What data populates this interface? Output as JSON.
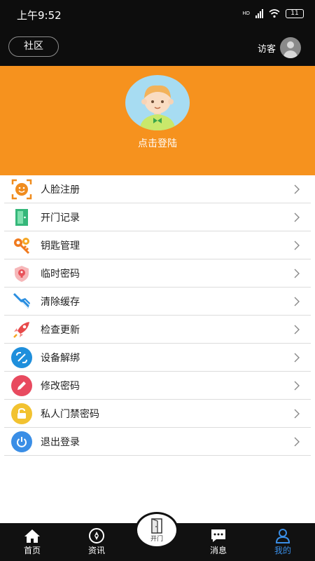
{
  "status_bar": {
    "time": "上午9:52",
    "network": "HD",
    "battery": "11"
  },
  "header": {
    "community_label": "社区",
    "visitor_label": "访客"
  },
  "profile": {
    "login_text": "点击登陆"
  },
  "menu": [
    {
      "label": "人脸注册",
      "icon": "face-scan-icon",
      "color": "#f08c1e"
    },
    {
      "label": "开门记录",
      "icon": "door-record-icon",
      "color": "#35b77a"
    },
    {
      "label": "钥匙管理",
      "icon": "key-icon",
      "color": "#f07a1e"
    },
    {
      "label": "临时密码",
      "icon": "temp-password-icon",
      "color": "#e8535a"
    },
    {
      "label": "清除缓存",
      "icon": "broom-icon",
      "color": "#2a8ee0"
    },
    {
      "label": "检查更新",
      "icon": "rocket-icon",
      "color": "#e84a4a"
    },
    {
      "label": "设备解绑",
      "icon": "unbind-icon",
      "color": "#1f8fdc"
    },
    {
      "label": "修改密码",
      "icon": "pencil-icon",
      "color": "#e84a5f"
    },
    {
      "label": "私人门禁密码",
      "icon": "lock-icon",
      "color": "#f2c230"
    },
    {
      "label": "退出登录",
      "icon": "power-icon",
      "color": "#3a8ee6"
    }
  ],
  "bottom_nav": {
    "home": "首页",
    "news": "资讯",
    "open": "开门",
    "messages": "消息",
    "mine": "我的"
  },
  "colors": {
    "accent": "#f6921e",
    "active_tab": "#3a8ee6",
    "dark": "#111111"
  }
}
